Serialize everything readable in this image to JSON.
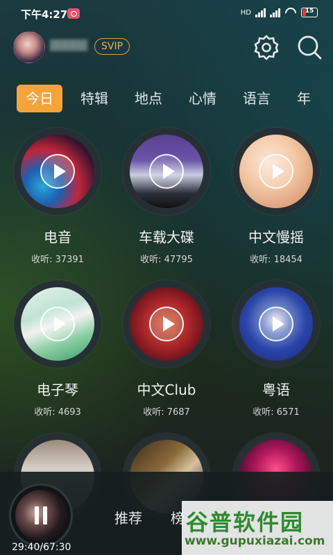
{
  "status_bar": {
    "time": "下午4:27",
    "network": "HD",
    "battery": "15"
  },
  "header": {
    "badge": "SVIP",
    "settings_icon": "gear-icon",
    "search_icon": "search-icon"
  },
  "tabs": [
    {
      "label": "今日",
      "active": true
    },
    {
      "label": "特辑"
    },
    {
      "label": "地点"
    },
    {
      "label": "心情"
    },
    {
      "label": "语言"
    },
    {
      "label": "年"
    }
  ],
  "cards": [
    {
      "title": "电音",
      "count": "收听: 37391"
    },
    {
      "title": "车载大碟",
      "count": "收听: 47795"
    },
    {
      "title": "中文慢摇",
      "count": "收听: 18454"
    },
    {
      "title": "电子琴",
      "count": "收听: 4693"
    },
    {
      "title": "中文Club",
      "count": "收听: 7687"
    },
    {
      "title": "粤语",
      "count": "收听: 6571"
    }
  ],
  "player": {
    "time": "29:40/67:30"
  },
  "bottom_nav": [
    {
      "label": "推荐"
    },
    {
      "label": "榜"
    }
  ],
  "watermark": {
    "title": "谷普软件园",
    "url": "www.gupuxiazai.com"
  },
  "colors": {
    "accent": "#f4a43a",
    "svip": "#d4a24a"
  }
}
